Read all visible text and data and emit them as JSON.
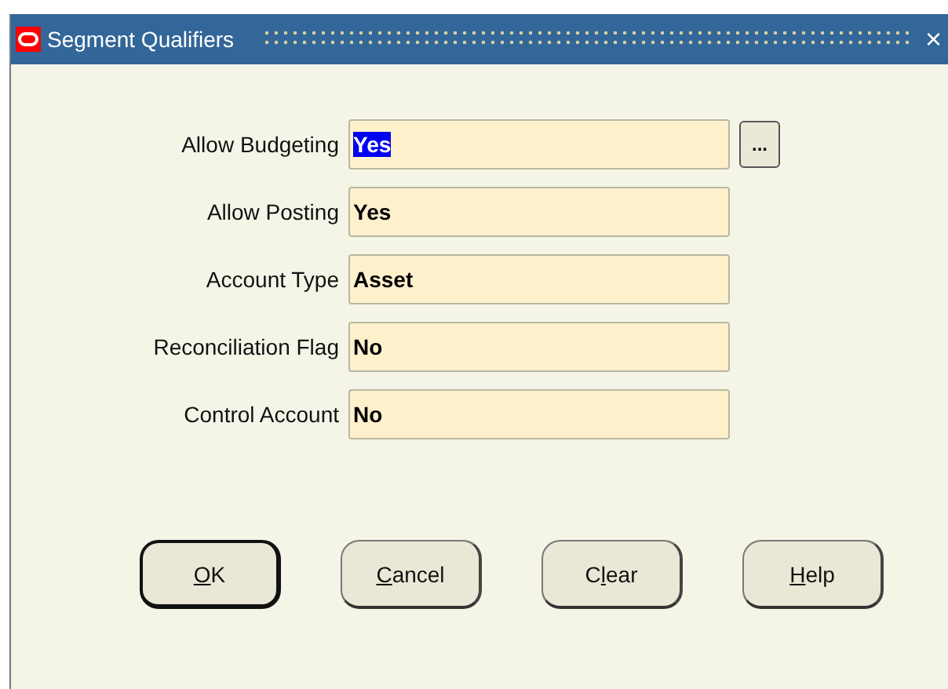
{
  "window": {
    "title": "Segment Qualifiers",
    "close": "×"
  },
  "fields": [
    {
      "label": "Allow Budgeting",
      "value": "Yes",
      "highlighted": true,
      "lov": true
    },
    {
      "label": "Allow Posting",
      "value": "Yes",
      "highlighted": false,
      "lov": false
    },
    {
      "label": "Account Type",
      "value": "Asset",
      "highlighted": false,
      "lov": false
    },
    {
      "label": "Reconciliation Flag",
      "value": "No",
      "highlighted": false,
      "lov": false
    },
    {
      "label": "Control Account",
      "value": "No",
      "highlighted": false,
      "lov": false
    }
  ],
  "lov_button": "...",
  "buttons": [
    {
      "key": "O",
      "after": "K",
      "default": true
    },
    {
      "key": "C",
      "after": "ancel",
      "default": false
    },
    {
      "before": "C",
      "key": "l",
      "after": "ear",
      "default": false
    },
    {
      "key": "H",
      "after": "elp",
      "default": false
    }
  ]
}
